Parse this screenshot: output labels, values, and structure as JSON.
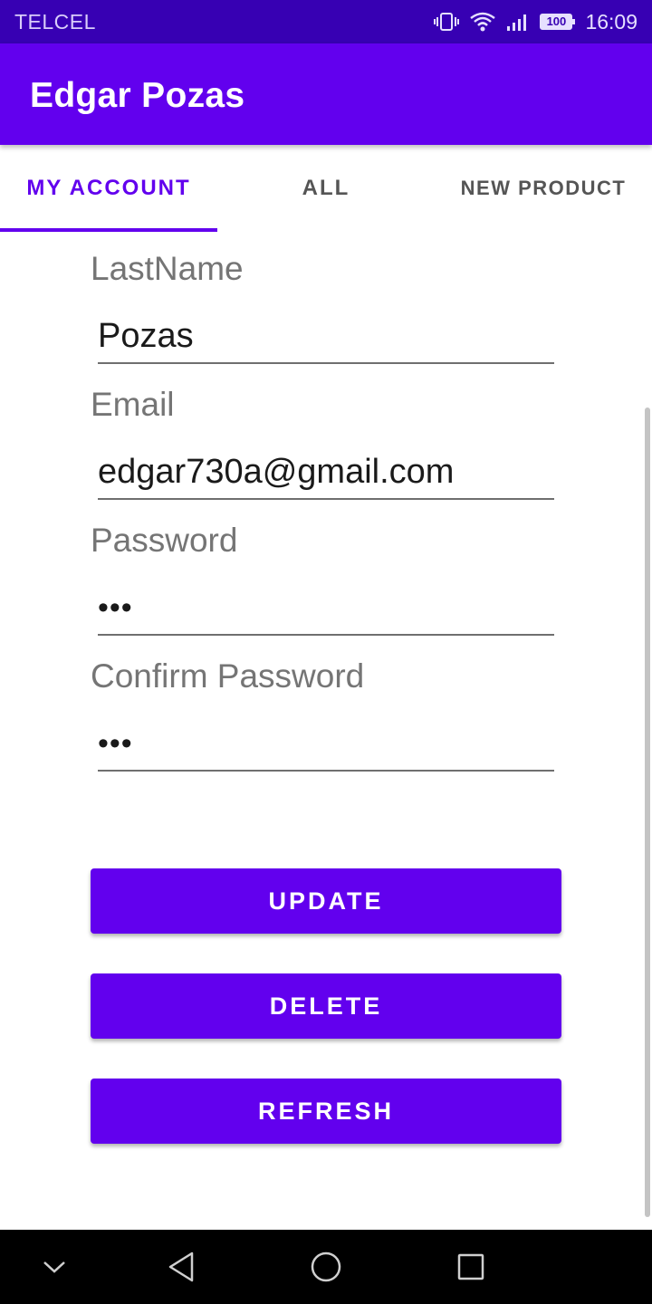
{
  "status_bar": {
    "carrier": "TELCEL",
    "battery": "100",
    "time": "16:09",
    "icons": [
      "vibrate-icon",
      "wifi-icon",
      "signal-icon",
      "battery-icon"
    ]
  },
  "app_bar": {
    "title": "Edgar Pozas"
  },
  "tabs": [
    {
      "label": "MY ACCOUNT",
      "active": true
    },
    {
      "label": "ALL",
      "active": false
    },
    {
      "label": "NEW PRODUCT",
      "active": false
    }
  ],
  "form": {
    "lastname": {
      "label": "LastName",
      "value": "Pozas"
    },
    "email": {
      "label": "Email",
      "value": "edgar730a@gmail.com"
    },
    "password": {
      "label": "Password",
      "value": "•••"
    },
    "confirm_password": {
      "label": "Confirm Password",
      "value": "•••"
    }
  },
  "buttons": {
    "update": "UPDATE",
    "delete": "DELETE",
    "refresh": "REFRESH"
  },
  "nav_bar": {
    "icons": [
      "chevron-down-icon",
      "back-icon",
      "home-icon",
      "recents-icon"
    ]
  },
  "colors": {
    "primary": "#6200EE",
    "primary_dark": "#3700B3"
  }
}
